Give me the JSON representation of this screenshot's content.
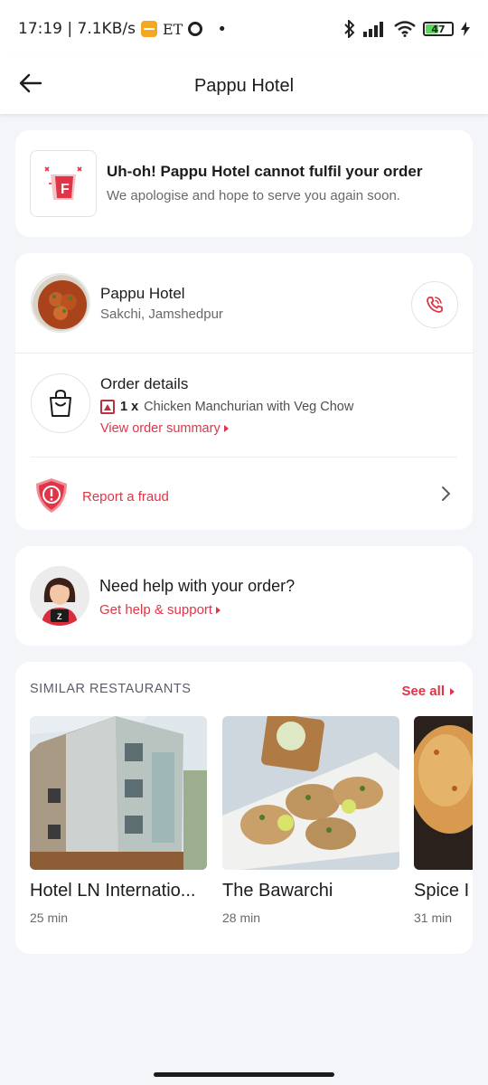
{
  "status_bar": {
    "time_speed": "17:19 | 7.1KB/s",
    "et_label": "ET",
    "dot": "•",
    "battery_level": "47"
  },
  "header": {
    "title": "Pappu Hotel"
  },
  "order_status": {
    "title": "Uh-oh! Pappu Hotel cannot fulfil your order",
    "subtitle": "We apologise and hope to serve you again soon.",
    "icon_letter": "F"
  },
  "restaurant": {
    "name": "Pappu Hotel",
    "location": "Sakchi, Jamshedpur"
  },
  "order_details": {
    "title": "Order details",
    "item_qty": "1 x",
    "item_name": "Chicken Manchurian with Veg Chow",
    "summary_link": "View order summary"
  },
  "fraud": {
    "label": "Report a fraud"
  },
  "help": {
    "title": "Need help with your order?",
    "link": "Get help & support",
    "avatar_badge": "Z"
  },
  "similar": {
    "heading": "SIMILAR RESTAURANTS",
    "see_all": "See all",
    "items": [
      {
        "name": "Hotel LN Internatio...",
        "time": "25 min"
      },
      {
        "name": "The Bawarchi",
        "time": "28 min"
      },
      {
        "name": "Spice I",
        "time": "31 min"
      }
    ]
  },
  "colors": {
    "accent": "#e03546",
    "background": "#f4f5f9"
  }
}
